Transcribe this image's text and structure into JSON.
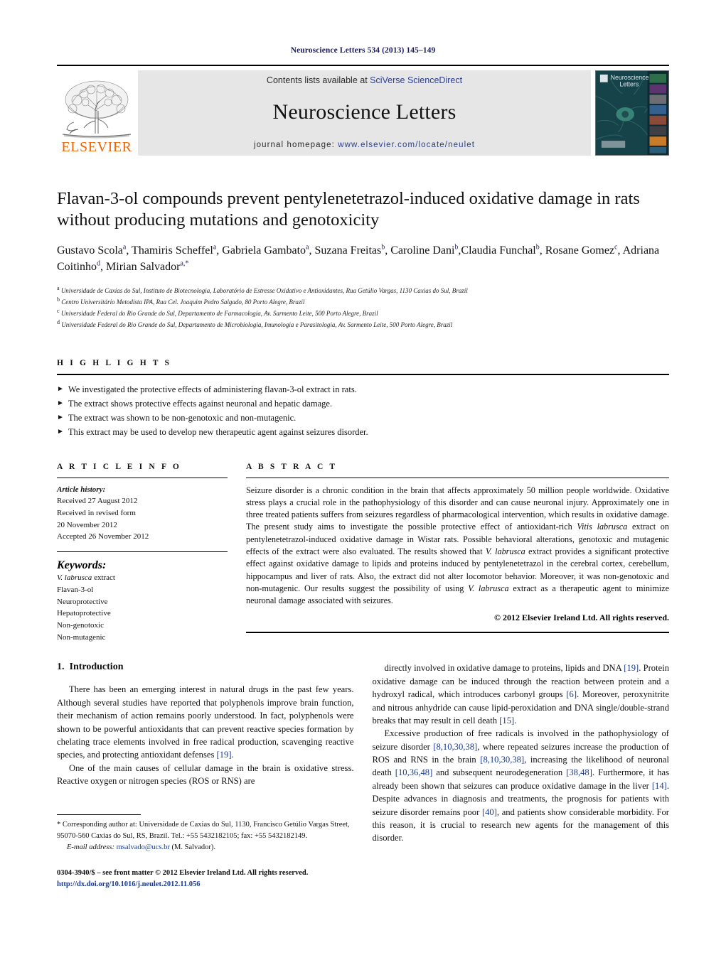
{
  "running_head": "Neuroscience Letters 534 (2013) 145–149",
  "masthead": {
    "publisher_name": "ELSEVIER",
    "contents_prefix": "Contents lists available at ",
    "contents_link": "SciVerse ScienceDirect",
    "journal_title": "Neuroscience Letters",
    "homepage_prefix": "journal homepage: ",
    "homepage_url": "www.elsevier.com/locate/neulet",
    "cover_title_line1": "Neuroscience",
    "cover_title_line2": "Letters",
    "link_color": "#2b3f8c",
    "elsevier_orange": "#ec6608"
  },
  "article": {
    "title": "Flavan-3-ol compounds prevent pentylenetetrazol-induced oxidative damage in rats without producing mutations and genotoxicity",
    "authors": [
      {
        "name": "Gustavo Scola",
        "sup": "a",
        "sep": ", "
      },
      {
        "name": "Thamiris Scheffel",
        "sup": "a",
        "sep": ", "
      },
      {
        "name": "Gabriela Gambato",
        "sup": "a",
        "sep": ", "
      },
      {
        "name": "Suzana Freitas",
        "sup": "b",
        "sep": ", "
      },
      {
        "name": "Caroline Dani",
        "sup": "b",
        "sep": ","
      },
      {
        "name": "Claudia Funchal",
        "sup": "b",
        "sep": ", "
      },
      {
        "name": "Rosane Gomez",
        "sup": "c",
        "sep": ", "
      },
      {
        "name": "Adriana Coitinho",
        "sup": "d",
        "sep": ", "
      },
      {
        "name": "Mirian Salvador",
        "sup": "a,*",
        "sep": ""
      }
    ],
    "affiliations": [
      {
        "marker": "a",
        "text": "Universidade de Caxias do Sul, Instituto de Biotecnologia, Laboratório de Estresse Oxidativo e Antioxidantes, Rua Getúlio Vargas, 1130 Caxias do Sul, Brazil"
      },
      {
        "marker": "b",
        "text": "Centro Universitário Metodista IPA, Rua Cel. Joaquim Pedro Salgado, 80 Porto Alegre, Brazil"
      },
      {
        "marker": "c",
        "text": "Universidade Federal do Rio Grande do Sul, Departamento de Farmacologia, Av. Sarmento Leite, 500 Porto Alegre, Brazil"
      },
      {
        "marker": "d",
        "text": "Universidade Federal do Rio Grande do Sul, Departamento de Microbiologia, Imunologia e Parasitologia, Av. Sarmento Leite, 500 Porto Alegre, Brazil"
      }
    ]
  },
  "highlights": {
    "heading": "H I G H L I G H T S",
    "items": [
      "We investigated the protective effects of administering flavan-3-ol extract in rats.",
      "The extract shows protective effects against neuronal and hepatic damage.",
      "The extract was shown to be non-genotoxic and non-mutagenic.",
      "This extract may be used to develop new therapeutic agent against seizures disorder."
    ],
    "bullet_glyph": "►"
  },
  "article_info": {
    "heading": "A R T I C L E    I N F O",
    "history_label": "Article history:",
    "history_lines": [
      "Received 27 August 2012",
      "Received in revised form",
      "20 November 2012",
      "Accepted 26 November 2012"
    ],
    "keywords_label": "Keywords:",
    "keywords": [
      "V. labrusca extract",
      "Flavan-3-ol",
      "Neuroprotective",
      "Hepatoprotective",
      "Non-genotoxic",
      "Non-mutagenic"
    ]
  },
  "abstract": {
    "heading": "A B S T R A C T",
    "part1": "Seizure disorder is a chronic condition in the brain that affects approximately 50 million people worldwide. Oxidative stress plays a crucial role in the pathophysiology of this disorder and can cause neuronal injury. Approximately one in three treated patients suffers from seizures regardless of pharmacological intervention, which results in oxidative damage. The present study aims to investigate the possible protective effect of antioxidant-rich ",
    "italic1": "Vitis labrusca",
    "part2": " extract on pentylenetetrazol-induced oxidative damage in Wistar rats. Possible behavioral alterations, genotoxic and mutagenic effects of the extract were also evaluated. The results showed that ",
    "italic2": "V. labrusca",
    "part3": " extract provides a significant protective effect against oxidative damage to lipids and proteins induced by pentylenetetrazol in the cerebral cortex, cerebellum, hippocampus and liver of rats. Also, the extract did not alter locomotor behavior. Moreover, it was non-genotoxic and non-mutagenic. Our results suggest the possibility of using ",
    "italic3": "V. labrusca",
    "part4": " extract as a therapeutic agent to minimize neuronal damage associated with seizures.",
    "copyright": "© 2012 Elsevier Ireland Ltd. All rights reserved."
  },
  "introduction": {
    "number": "1.",
    "heading": "Introduction",
    "left_paragraphs": [
      "There has been an emerging interest in natural drugs in the past few years. Although several studies have reported that polyphenols improve brain function, their mechanism of action remains poorly understood. In fact, polyphenols were shown to be powerful antioxidants that can prevent reactive species formation by chelating trace elements involved in free radical production, scavenging reactive species, and protecting antioxidant defenses [19].",
      "One of the main causes of cellular damage in the brain is oxidative stress. Reactive oxygen or nitrogen species (ROS or RNS) are"
    ],
    "right_paragraphs": [
      "directly involved in oxidative damage to proteins, lipids and DNA [19]. Protein oxidative damage can be induced through the reaction between protein and a hydroxyl radical, which introduces carbonyl groups [6]. Moreover, peroxynitrite and nitrous anhydride can cause lipid-peroxidation and DNA single/double-strand breaks that may result in cell death [15].",
      "Excessive production of free radicals is involved in the pathophysiology of seizure disorder [8,10,30,38], where repeated seizures increase the production of ROS and RNS in the brain [8,10,30,38], increasing the likelihood of neuronal death [10,36,48] and subsequent neurodegeneration [38,48]. Furthermore, it has already been shown that seizures can produce oxidative damage in the liver [14]. Despite advances in diagnosis and treatments, the prognosis for patients with seizure disorder remains poor [40], and patients show considerable morbidity. For this reason, it is crucial to research new agents for the management of this disorder."
    ]
  },
  "footnotes": {
    "corresponding_marker": "*",
    "corresponding_text": "Corresponding author at: Universidade de Caxias do Sul, 1130, Francisco Getúlio Vargas Street, 95070-560 Caxias do Sul, RS, Brazil. Tel.: +55 5432182105; fax: +55 5432182149.",
    "email_label": "E-mail address:",
    "email_address": "msalvado@ucs.br",
    "email_person": " (M. Salvador).",
    "issn_line": "0304-3940/$ – see front matter © 2012 Elsevier Ireland Ltd. All rights reserved.",
    "doi_line": "http://dx.doi.org/10.1016/j.neulet.2012.11.056"
  }
}
